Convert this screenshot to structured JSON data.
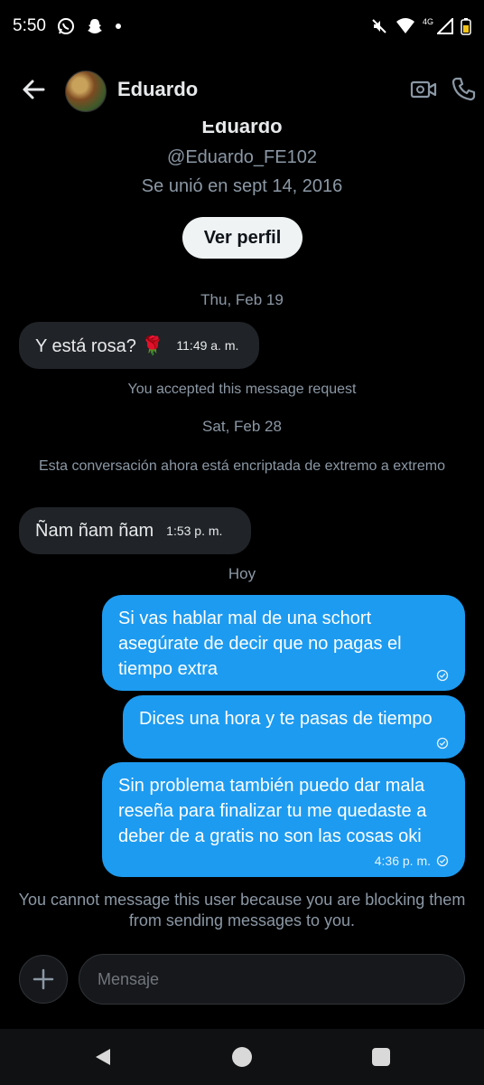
{
  "status_bar": {
    "time": "5:50",
    "network_label": "4G",
    "icons": [
      "whatsapp-icon",
      "snapchat-icon",
      "dot-icon",
      "mute-icon",
      "wifi-icon",
      "signal-icon",
      "battery-icon"
    ]
  },
  "header": {
    "name": "Eduardo",
    "icons": [
      "back-arrow-icon",
      "video-icon",
      "phone-icon"
    ]
  },
  "profile": {
    "name": "Eduardo",
    "handle": "@Eduardo_FE102",
    "joined": "Se unió en sept 14, 2016",
    "view_profile_label": "Ver perfil"
  },
  "conversation": {
    "day1": "Thu, Feb 19",
    "msg1_text": "Y está rosa? 🌹",
    "msg1_time": "11:49 a. m.",
    "accepted_note": "You accepted this message request",
    "day2": "Sat, Feb 28",
    "encrypted_note": "Esta conversación ahora está encriptada de extremo a extremo",
    "msg2_text": "Ñam ñam ñam",
    "msg2_time": "1:53 p. m.",
    "day3": "Hoy",
    "out1_text": "Si vas hablar mal de una schort asegúrate de decir que no pagas el tiempo extra",
    "out2_text": "Dices una hora y te pasas de tiempo",
    "out3_text": "Sin problema también puedo dar mala reseña para finalizar tu me quedaste a deber de a gratis no son las cosas oki",
    "out3_time": "4:36 p. m."
  },
  "blocked_note": "You cannot message this user because you are blocking them from sending messages to you.",
  "composer": {
    "placeholder": "Mensaje",
    "add_icon": "plus-icon"
  },
  "colors": {
    "background": "#000000",
    "outgoing_bubble": "#1d9bf0",
    "incoming_bubble": "#202327",
    "muted_text": "#8b98a5"
  }
}
